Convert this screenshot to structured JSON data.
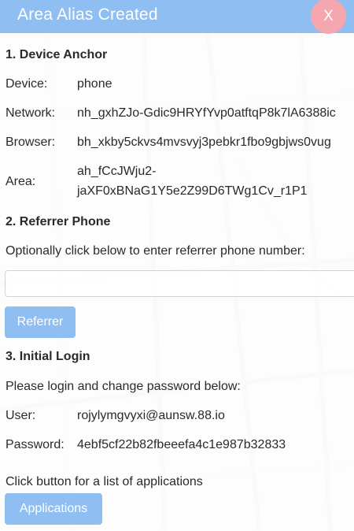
{
  "dialog": {
    "title": "Area Alias Created",
    "close_label": "X"
  },
  "section1": {
    "title": "1. Device Anchor",
    "rows": [
      {
        "label": "Device:",
        "value": "phone"
      },
      {
        "label": "Network:",
        "value": "nh_gxhZJo-Gdic9HRYfYvp0atftqP8k7lA6388ic"
      },
      {
        "label": "Browser:",
        "value": "bh_xkby5ckvs4mvsvyj3pebkr1fbo9gbjws0vug"
      },
      {
        "label": "Area:",
        "value_line1": "ah_fCcJWju2-",
        "value_line2": "jaXF0xBNaG1Y5e2Z99D6TWg1Cv_r1P1"
      }
    ]
  },
  "section2": {
    "title": "2. Referrer Phone",
    "instruction": "Optionally click below to enter referrer phone number:",
    "input_value": "",
    "input_placeholder": "",
    "button_label": "Referrer"
  },
  "section3": {
    "title": "3. Initial Login",
    "instruction": "Please login and change password below:",
    "user_label": "User:",
    "user_value": "rojylymgvyxi@aunsw.88.io",
    "password_label": "Password:",
    "password_value": "4ebf5cf22b82fbeeefa4c1e987b32833",
    "apps_instruction": "Click button for a list of applications",
    "apps_button_label": "Applications"
  },
  "colors": {
    "header": "#8fbff2",
    "close_button": "#f4a7ae",
    "button": "#8fbff2"
  }
}
